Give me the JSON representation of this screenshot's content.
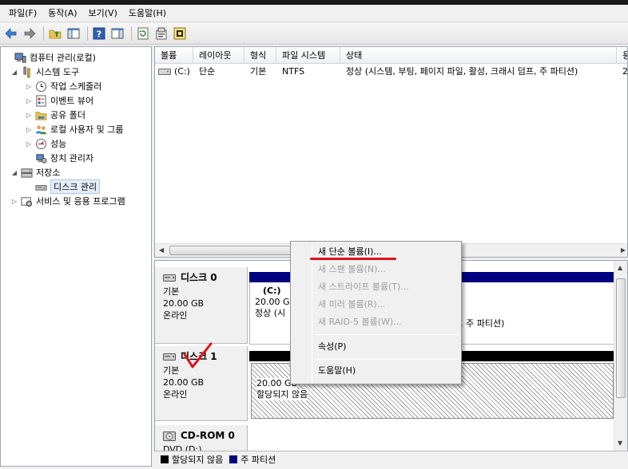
{
  "menubar": [
    {
      "id": "file",
      "label": "파일(F)"
    },
    {
      "id": "action",
      "label": "동작(A)"
    },
    {
      "id": "view",
      "label": "보기(V)"
    },
    {
      "id": "help",
      "label": "도움말(H)"
    }
  ],
  "toolbar": [
    {
      "name": "back-icon"
    },
    {
      "name": "forward-icon"
    },
    {
      "sep": true
    },
    {
      "name": "up-folder-icon"
    },
    {
      "name": "show-hide-tree-icon"
    },
    {
      "sep": true
    },
    {
      "name": "help-icon"
    },
    {
      "name": "show-action-pane-icon"
    },
    {
      "sep": true
    },
    {
      "name": "refresh-icon"
    },
    {
      "name": "properties-icon"
    },
    {
      "name": "rescan-disks-icon"
    }
  ],
  "tree": [
    {
      "label": "컴퓨터 관리(로컬)",
      "indent": 0,
      "expander": "",
      "icon": "computer-management-icon"
    },
    {
      "label": "시스템 도구",
      "indent": 1,
      "expander": "◢",
      "icon": "system-tools-icon"
    },
    {
      "label": "작업 스케줄러",
      "indent": 2,
      "expander": "▷",
      "icon": "clock-icon"
    },
    {
      "label": "이벤트 뷰어",
      "indent": 2,
      "expander": "▷",
      "icon": "event-viewer-icon"
    },
    {
      "label": "공유 폴더",
      "indent": 2,
      "expander": "▷",
      "icon": "shared-folder-icon"
    },
    {
      "label": "로컬 사용자 및 그룹",
      "indent": 2,
      "expander": "▷",
      "icon": "users-icon"
    },
    {
      "label": "성능",
      "indent": 2,
      "expander": "▷",
      "icon": "performance-icon"
    },
    {
      "label": "장치 관리자",
      "indent": 2,
      "expander": "",
      "icon": "device-manager-icon"
    },
    {
      "label": "저장소",
      "indent": 1,
      "expander": "◢",
      "icon": "storage-icon"
    },
    {
      "label": "디스크 관리",
      "indent": 2,
      "expander": "",
      "icon": "disk-management-icon",
      "selected": true
    },
    {
      "label": "서비스 및 응용 프로그램",
      "indent": 1,
      "expander": "▷",
      "icon": "services-icon"
    }
  ],
  "volume_list": {
    "columns": [
      "볼륨",
      "레이아웃",
      "형식",
      "파일 시스템",
      "상태",
      "용"
    ],
    "rows": [
      {
        "volume": "(C:)",
        "layout": "단순",
        "type": "기본",
        "filesystem": "NTFS",
        "status": "정상 (시스템, 부팅, 페이지 파일, 활성, 크래시 덤프, 주 파티션)",
        "capacity": "2"
      }
    ]
  },
  "disks": [
    {
      "name": "디스크 0",
      "kind": "기본",
      "size": "20.00 GB",
      "state": "온라인",
      "partition": {
        "title": "(C:)",
        "size": "20.00 GB",
        "status": "정상 (시",
        "status_tail": "프, 주 파티션)",
        "bar_color": "#000080"
      }
    },
    {
      "name": "디스크 1",
      "kind": "기본",
      "size": "20.00 GB",
      "state": "온라인",
      "partition": {
        "size": "20.00 GB",
        "status": "할당되지 않음",
        "bar_color": "#000000"
      }
    },
    {
      "name": "CD-ROM 0",
      "kind": "DVD (D:)"
    }
  ],
  "legend": [
    {
      "label": "할당되지 않음",
      "color": "#000000"
    },
    {
      "label": "주 파티션",
      "color": "#000080"
    }
  ],
  "context_menu": {
    "items": [
      {
        "label": "새 단순 볼륨(I)...",
        "disabled": false
      },
      {
        "label": "새 스팬 볼륨(N)...",
        "disabled": true
      },
      {
        "label": "새 스트라이프 볼륨(T)...",
        "disabled": true
      },
      {
        "label": "새 미러 볼륨(R)...",
        "disabled": true
      },
      {
        "label": "새 RAID-5 볼륨(W)...",
        "disabled": true
      },
      {
        "sep": true
      },
      {
        "label": "속성(P)",
        "disabled": false
      },
      {
        "sep": true
      },
      {
        "label": "도움말(H)",
        "disabled": false
      }
    ]
  },
  "annotation_color": "#e0101a"
}
